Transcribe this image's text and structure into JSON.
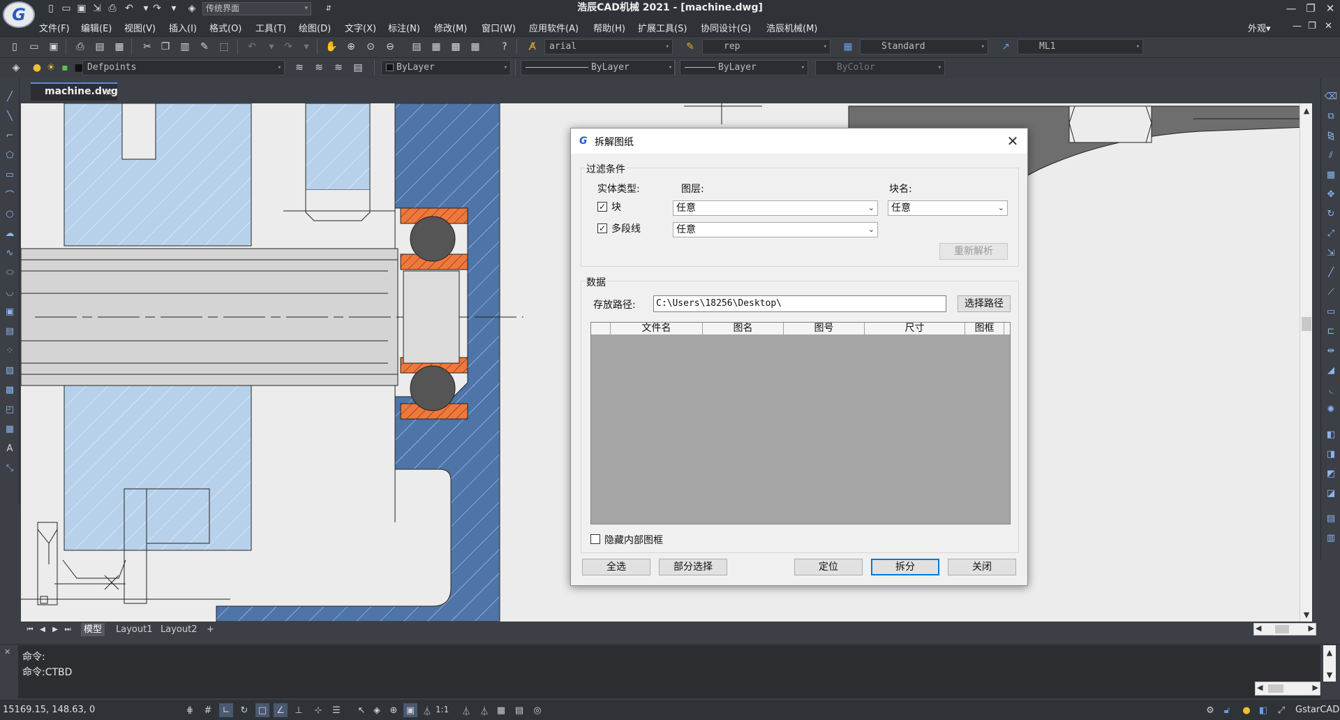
{
  "titlebar": {
    "logo_letter": "G",
    "workspace": "传统界面",
    "window_title": "浩辰CAD机械 2021 - [machine.dwg]",
    "minimize": "—",
    "restore": "❐",
    "close": "✕"
  },
  "menubar": {
    "items": [
      "文件(F)",
      "编辑(E)",
      "视图(V)",
      "插入(I)",
      "格式(O)",
      "工具(T)",
      "绘图(D)",
      "文字(X)",
      "标注(N)",
      "修改(M)",
      "窗口(W)",
      "应用软件(A)",
      "帮助(H)",
      "扩展工具(S)",
      "协同设计(G)",
      "浩辰机械(M)"
    ],
    "appearance": "外观▾",
    "doc_min": "—",
    "doc_restore": "❐",
    "doc_close": "✕"
  },
  "toolbar1": {
    "font_combo": "arial",
    "dimstyle_combo": "rep",
    "textstyle_combo": "Standard",
    "mlstyle_combo": "ML1"
  },
  "toolbar2": {
    "layer_combo": "Defpoints",
    "color_combo": "ByLayer",
    "linetype_combo": "ByLayer",
    "lineweight_combo": "ByLayer",
    "plotstyle_combo": "ByColor"
  },
  "document_tab": {
    "name": "machine.dwg",
    "close": "✕"
  },
  "layout_tabs": [
    "模型",
    "Layout1",
    "Layout2",
    "+"
  ],
  "command": {
    "lines": [
      "命令:",
      "命令:CTBD"
    ]
  },
  "statusbar": {
    "coordinates": "15169.15, 148.63, 0",
    "scale": "1:1",
    "brand": "GstarCAD"
  },
  "dialog": {
    "title": "拆解图纸",
    "filter_group": "过滤条件",
    "entity_type_label": "实体类型:",
    "layer_label": "图层:",
    "block_name_label": "块名:",
    "check_block": {
      "label": "块",
      "checked": true
    },
    "check_polyline": {
      "label": "多段线",
      "checked": true
    },
    "layer_value_1": "任意",
    "layer_value_2": "任意",
    "block_value": "任意",
    "reparse_button": "重新解析",
    "data_group": "数据",
    "path_label": "存放路径:",
    "path_value": "C:\\Users\\18256\\Desktop\\",
    "choose_path_button": "选择路径",
    "columns": [
      "",
      "文件名",
      "图名",
      "图号",
      "尺寸",
      "图框"
    ],
    "hide_inner_frame": {
      "label": "隐藏内部图框",
      "checked": false
    },
    "buttons": {
      "select_all": "全选",
      "partial_select": "部分选择",
      "locate": "定位",
      "split": "拆分",
      "close": "关闭"
    }
  }
}
